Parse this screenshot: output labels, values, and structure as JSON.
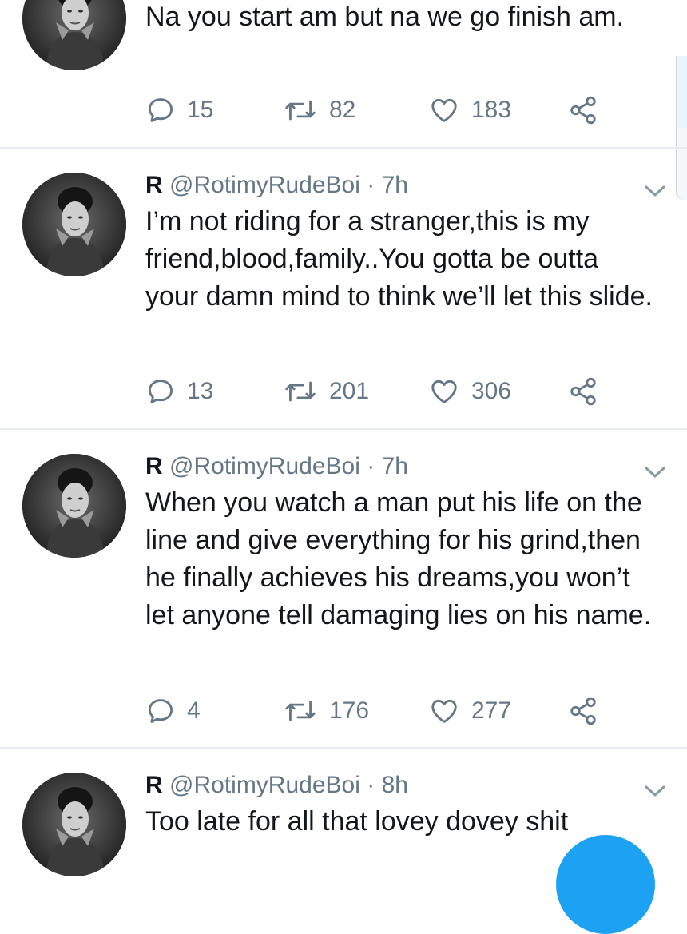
{
  "tweets": [
    {
      "name": "",
      "handle": "",
      "time": "",
      "text": "Na you start am but na we go finish am.",
      "replies": "15",
      "retweets": "82",
      "likes": "183"
    },
    {
      "name": "R",
      "handle": "@RotimyRudeBoi",
      "dot": "·",
      "time": "7h",
      "text": "I’m not riding for a stranger,this is my friend,blood,family..You gotta be outta your damn mind to think we’ll let this slide.",
      "replies": "13",
      "retweets": "201",
      "likes": "306"
    },
    {
      "name": "R",
      "handle": "@RotimyRudeBoi",
      "dot": "·",
      "time": "7h",
      "text": "When you watch a man put his life on the line and give everything for his grind,then he finally achieves his dreams,you won’t let anyone tell damaging lies on his name.",
      "replies": "4",
      "retweets": "176",
      "likes": "277"
    },
    {
      "name": "R",
      "handle": "@RotimyRudeBoi",
      "dot": "·",
      "time": "8h",
      "text": "Too late for all that lovey dovey shit"
    }
  ],
  "icons": {
    "reply": "reply-icon",
    "retweet": "retweet-icon",
    "like": "heart-icon",
    "share": "share-icon",
    "more": "chevron-down-icon"
  },
  "colors": {
    "text": "#14171a",
    "secondary": "#657786",
    "divider": "#e6ecf0",
    "accent": "#1da1f2"
  }
}
